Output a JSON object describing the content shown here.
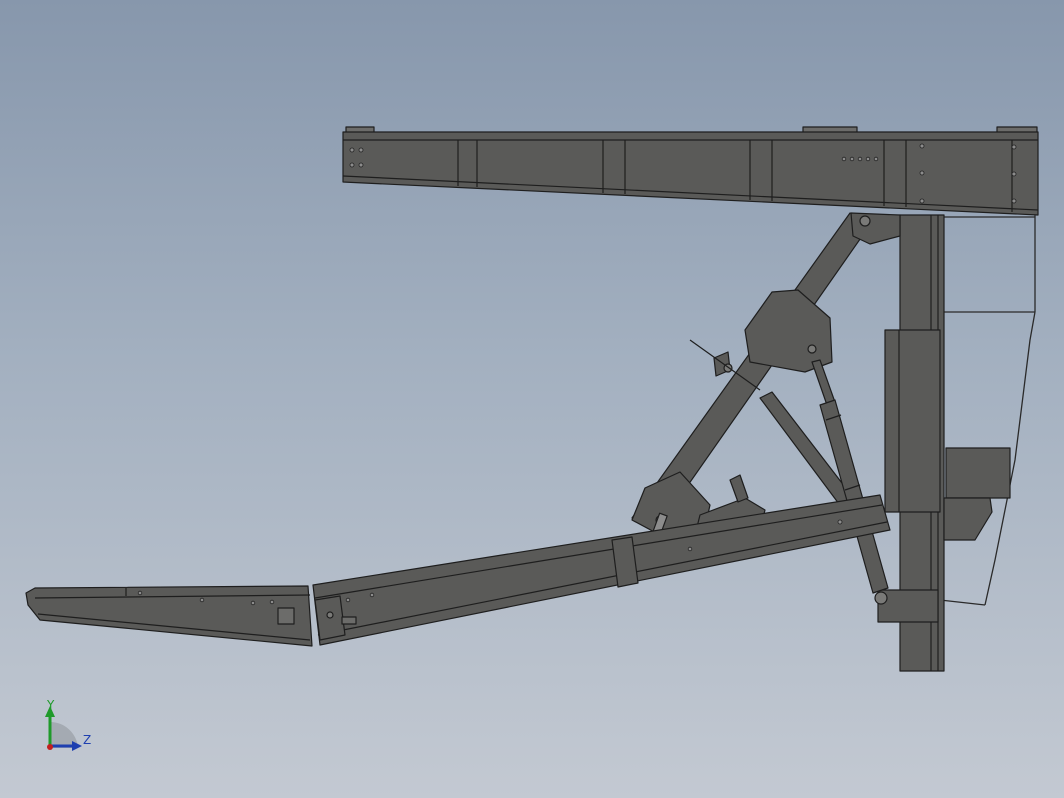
{
  "viewport": {
    "background_top": "#8797ac",
    "background_bottom": "#c3c9d2"
  },
  "model": {
    "part_color": "#5a5a58",
    "edge_color": "#1e1e1e",
    "highlight_color": "#6c6c6a"
  },
  "triad": {
    "y_label": "Y",
    "z_label": "Z",
    "y_color": "#1f9a2a",
    "z_color": "#1e3fb0",
    "x_color": "#c21e1e"
  }
}
